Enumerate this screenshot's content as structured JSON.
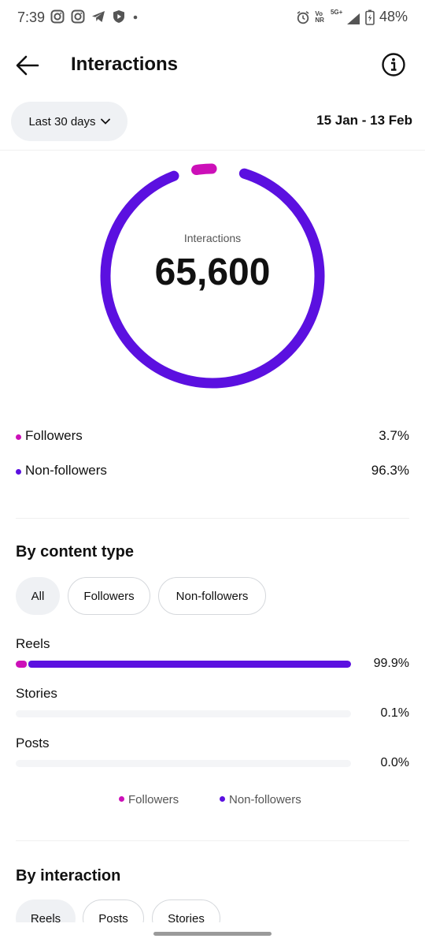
{
  "status_bar": {
    "time": "7:39",
    "volte": "Vo",
    "nr": "NR",
    "network": "5G+",
    "battery": "48%"
  },
  "header": {
    "title": "Interactions"
  },
  "filter": {
    "range_label": "Last 30 days",
    "date_range": "15 Jan - 13 Feb"
  },
  "summary": {
    "label": "Interactions",
    "total": "65,600"
  },
  "colors": {
    "followers": "#cc10b8",
    "non_followers": "#5b10e0"
  },
  "audience_split": [
    {
      "label": "Followers",
      "value": "3.7%",
      "fraction": 0.037
    },
    {
      "label": "Non-followers",
      "value": "96.3%",
      "fraction": 0.963
    }
  ],
  "content_type": {
    "title": "By content type",
    "chips": [
      "All",
      "Followers",
      "Non-followers"
    ],
    "rows": [
      {
        "label": "Reels",
        "value": "99.9%",
        "fraction": 0.999,
        "followers_fraction": 0.037
      },
      {
        "label": "Stories",
        "value": "0.1%",
        "fraction": 0.001,
        "followers_fraction": 0
      },
      {
        "label": "Posts",
        "value": "0.0%",
        "fraction": 0.0,
        "followers_fraction": 0
      }
    ],
    "legend": [
      "Followers",
      "Non-followers"
    ]
  },
  "interaction": {
    "title": "By interaction",
    "chips": [
      "Reels",
      "Posts",
      "Stories"
    ]
  }
}
